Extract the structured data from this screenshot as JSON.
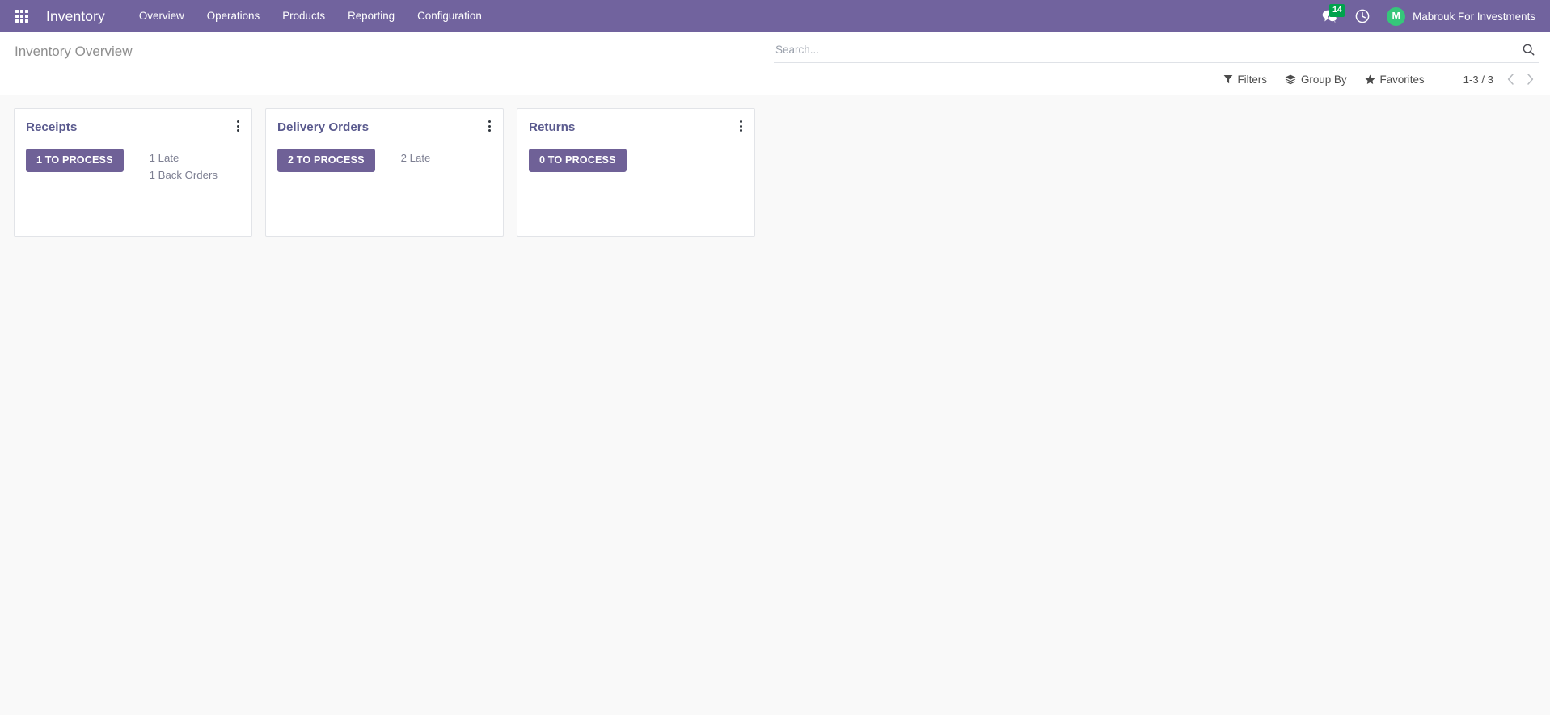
{
  "navbar": {
    "apps_menu_label": "apps-grid",
    "brand": "Inventory",
    "menu_items": [
      {
        "label": "Overview"
      },
      {
        "label": "Operations"
      },
      {
        "label": "Products"
      },
      {
        "label": "Reporting"
      },
      {
        "label": "Configuration"
      }
    ],
    "messages_icon": "messages-icon",
    "messages_count": "14",
    "activities_icon": "clock-icon",
    "avatar_initial": "M",
    "user_name": "Mabrouk For Investments",
    "background_color": "#71639e",
    "badge_color": "#00a24d",
    "avatar_color": "#35c77a"
  },
  "control_panel": {
    "breadcrumb": "Inventory Overview",
    "search": {
      "placeholder": "Search...",
      "value": "",
      "icon": "search-icon"
    },
    "filters_label": "Filters",
    "filters_icon": "filter-icon",
    "group_by_label": "Group By",
    "group_by_icon": "layers-icon",
    "favorites_label": "Favorites",
    "favorites_icon": "star-icon",
    "pager": {
      "value": "1-3 / 3",
      "previous_icon": "chevron-left-icon",
      "next_icon": "chevron-right-icon"
    }
  },
  "kanban": {
    "accent_color": "#6f6197",
    "title_color": "#5a5a8e",
    "cards": [
      {
        "title": "Receipts",
        "menu_icon": "ellipsis-vertical-icon",
        "button_label": "1 TO PROCESS",
        "links": [
          {
            "label": "1 Late"
          },
          {
            "label": "1 Back Orders"
          }
        ]
      },
      {
        "title": "Delivery Orders",
        "menu_icon": "ellipsis-vertical-icon",
        "button_label": "2 TO PROCESS",
        "links": [
          {
            "label": "2 Late"
          }
        ]
      },
      {
        "title": "Returns",
        "menu_icon": "ellipsis-vertical-icon",
        "button_label": "0 TO PROCESS",
        "links": []
      }
    ]
  }
}
